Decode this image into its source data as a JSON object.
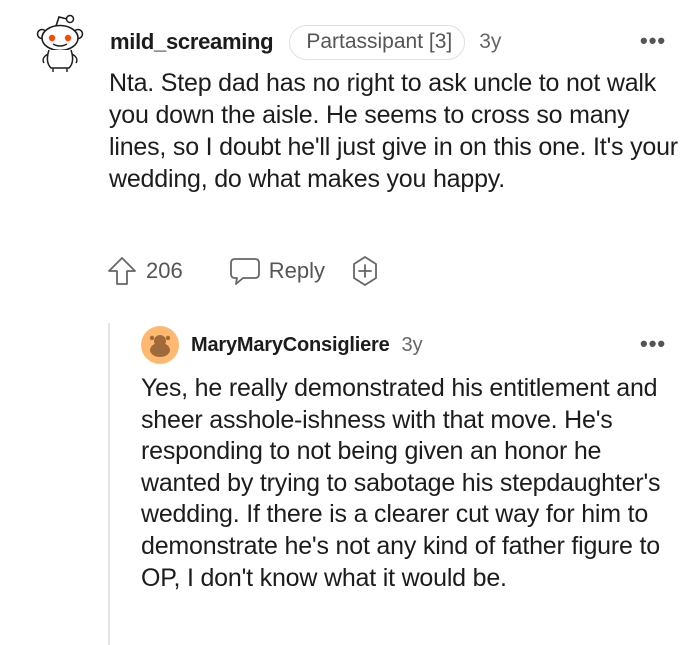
{
  "comment": {
    "username": "mild_screaming",
    "flair": "Partassipant [3]",
    "age": "3y",
    "more": "•••",
    "body": "Nta. Step dad has no right to ask uncle to not walk you down the aisle. He seems to cross so many lines, so I doubt he'll just give in on this one. It's your wedding, do what makes you happy.",
    "score": "206",
    "reply_label": "Reply",
    "icons": {
      "avatar": "reddit-snoo-avatar-icon",
      "upvote": "upvote-arrow-icon",
      "reply": "speech-bubble-icon",
      "award": "add-award-icon"
    }
  },
  "reply": {
    "username": "MaryMaryConsigliere",
    "age": "3y",
    "more": "•••",
    "body": "Yes, he really demonstrated his entitlement and sheer asshole-ishness with that move. He's responding to not being given an honor he wanted by trying to sabotage his stepdaughter's wedding. If there is a clearer cut way for him to demonstrate he's not any kind of father figure to OP, I don't know what it would be.",
    "icons": {
      "avatar": "user-avatar-icon"
    }
  },
  "colors": {
    "text": "#1c1c1c",
    "meta": "#555555",
    "snoo_eye": "#ff4500",
    "avatar_bg": "#ffb870",
    "thread_line": "#e5e5e5"
  }
}
